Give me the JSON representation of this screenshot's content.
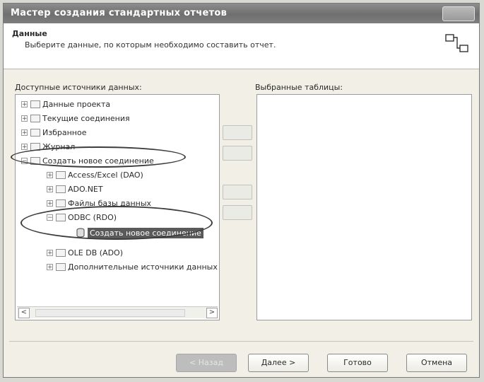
{
  "window": {
    "title": "Мастер создания стандартных отчетов"
  },
  "header": {
    "title": "Данные",
    "subtitle": "Выберите данные, по которым необходимо составить отчет.",
    "icon": "tables-link-icon"
  },
  "left_panel": {
    "label": "Доступные источники данных:",
    "tree": [
      {
        "label": "Данные проекта",
        "level": 0,
        "expander": "+"
      },
      {
        "label": "Текущие соединения",
        "level": 0,
        "expander": "+"
      },
      {
        "label": "Избранное",
        "level": 0,
        "expander": "+"
      },
      {
        "label": "Журнал",
        "level": 0,
        "expander": "+"
      },
      {
        "label": "Создать новое соединение",
        "level": 0,
        "expander": "−"
      },
      {
        "label": "Access/Excel (DAO)",
        "level": 1,
        "expander": "+"
      },
      {
        "label": "ADO.NET",
        "level": 1,
        "expander": "+"
      },
      {
        "label": "Файлы базы данных",
        "level": 1,
        "expander": "+"
      },
      {
        "label": "ODBC (RDO)",
        "level": 1,
        "expander": "−"
      },
      {
        "label": "Создать новое соединение",
        "level": 2,
        "expander": "",
        "selected": true
      },
      {
        "label": "OLE DB (ADO)",
        "level": 1,
        "expander": "+"
      },
      {
        "label": "Дополнительные источники данных",
        "level": 1,
        "expander": "+"
      }
    ],
    "scroll_left": "<",
    "scroll_right": ">"
  },
  "right_panel": {
    "label": "Выбранные таблицы:"
  },
  "footer": {
    "back": "< Назад",
    "next": "Далее >",
    "finish": "Готово",
    "cancel": "Отмена"
  }
}
